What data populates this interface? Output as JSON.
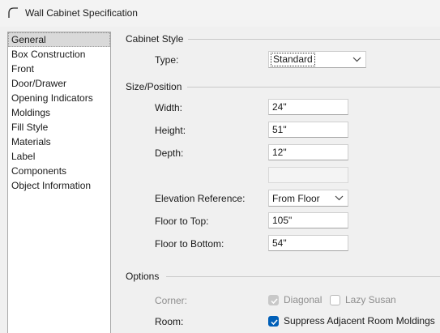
{
  "window": {
    "title": "Wall Cabinet Specification",
    "icon": "cabinet-arc-icon"
  },
  "nav": {
    "items": [
      {
        "label": "General",
        "selected": true
      },
      {
        "label": "Box Construction",
        "selected": false
      },
      {
        "label": "Front",
        "selected": false
      },
      {
        "label": "Door/Drawer",
        "selected": false
      },
      {
        "label": "Opening Indicators",
        "selected": false
      },
      {
        "label": "Moldings",
        "selected": false
      },
      {
        "label": "Fill Style",
        "selected": false
      },
      {
        "label": "Materials",
        "selected": false
      },
      {
        "label": "Label",
        "selected": false
      },
      {
        "label": "Components",
        "selected": false
      },
      {
        "label": "Object Information",
        "selected": false
      }
    ]
  },
  "cabinet_style": {
    "header": "Cabinet Style",
    "type_label": "Type:",
    "type_value": "Standard"
  },
  "size_position": {
    "header": "Size/Position",
    "width_label": "Width:",
    "width_value": "24\"",
    "height_label": "Height:",
    "height_value": "51\"",
    "depth_label": "Depth:",
    "depth_value": "12\"",
    "blank_field_value": "",
    "elevation_label": "Elevation Reference:",
    "elevation_value": "From Floor",
    "floor_top_label": "Floor to Top:",
    "floor_top_value": "105\"",
    "floor_bottom_label": "Floor to Bottom:",
    "floor_bottom_value": "54\""
  },
  "options": {
    "header": "Options",
    "corner_label": "Corner:",
    "diagonal_label": "Diagonal",
    "diagonal_checked": true,
    "diagonal_enabled": false,
    "lazy_susan_label": "Lazy Susan",
    "lazy_susan_checked": false,
    "lazy_susan_enabled": false,
    "room_label": "Room:",
    "suppress_label": "Suppress Adjacent Room Moldings",
    "suppress_checked": true
  },
  "colors": {
    "accent": "#005fb8",
    "selected_nav": "#d9d9d9",
    "disabled_text": "#8e8e8e"
  }
}
